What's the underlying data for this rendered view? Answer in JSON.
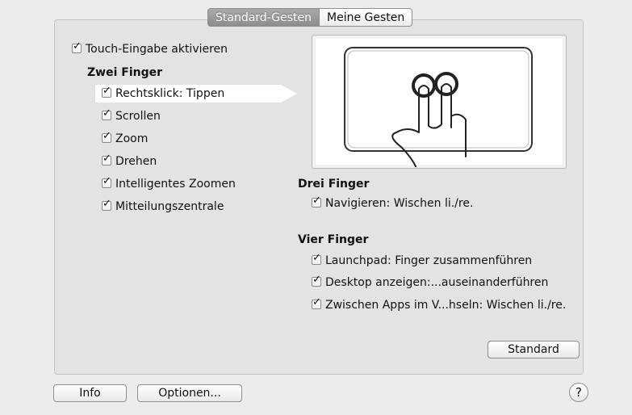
{
  "tabs": [
    {
      "label": "Standard-Gesten",
      "active": true
    },
    {
      "label": "Meine Gesten",
      "active": false
    }
  ],
  "touch_enable": {
    "label": "Touch-Eingabe aktivieren",
    "checked": true
  },
  "two_fingers": {
    "heading": "Zwei Finger",
    "items": [
      {
        "label": "Rechtsklick: Tippen",
        "checked": true,
        "selected": true
      },
      {
        "label": "Scrollen",
        "checked": true
      },
      {
        "label": "Zoom",
        "checked": true
      },
      {
        "label": "Drehen",
        "checked": true
      },
      {
        "label": "Intelligentes Zoomen",
        "checked": true
      },
      {
        "label": "Mitteilungszentrale",
        "checked": true
      }
    ]
  },
  "three_fingers": {
    "heading": "Drei Finger",
    "items": [
      {
        "label": "Navigieren: Wischen li./re.",
        "checked": true
      }
    ]
  },
  "four_fingers": {
    "heading": "Vier Finger",
    "items": [
      {
        "label": "Launchpad: Finger zusammenführen",
        "checked": true
      },
      {
        "label": "Desktop anzeigen:...auseinanderführen",
        "checked": true
      },
      {
        "label": "Zwischen Apps im V...hseln: Wischen li./re.",
        "checked": true
      }
    ]
  },
  "buttons": {
    "standard": "Standard",
    "info": "Info",
    "options": "Optionen...",
    "help": "?"
  },
  "checkmark": "✓",
  "preview_icon": "two-finger-tap-hand-icon"
}
